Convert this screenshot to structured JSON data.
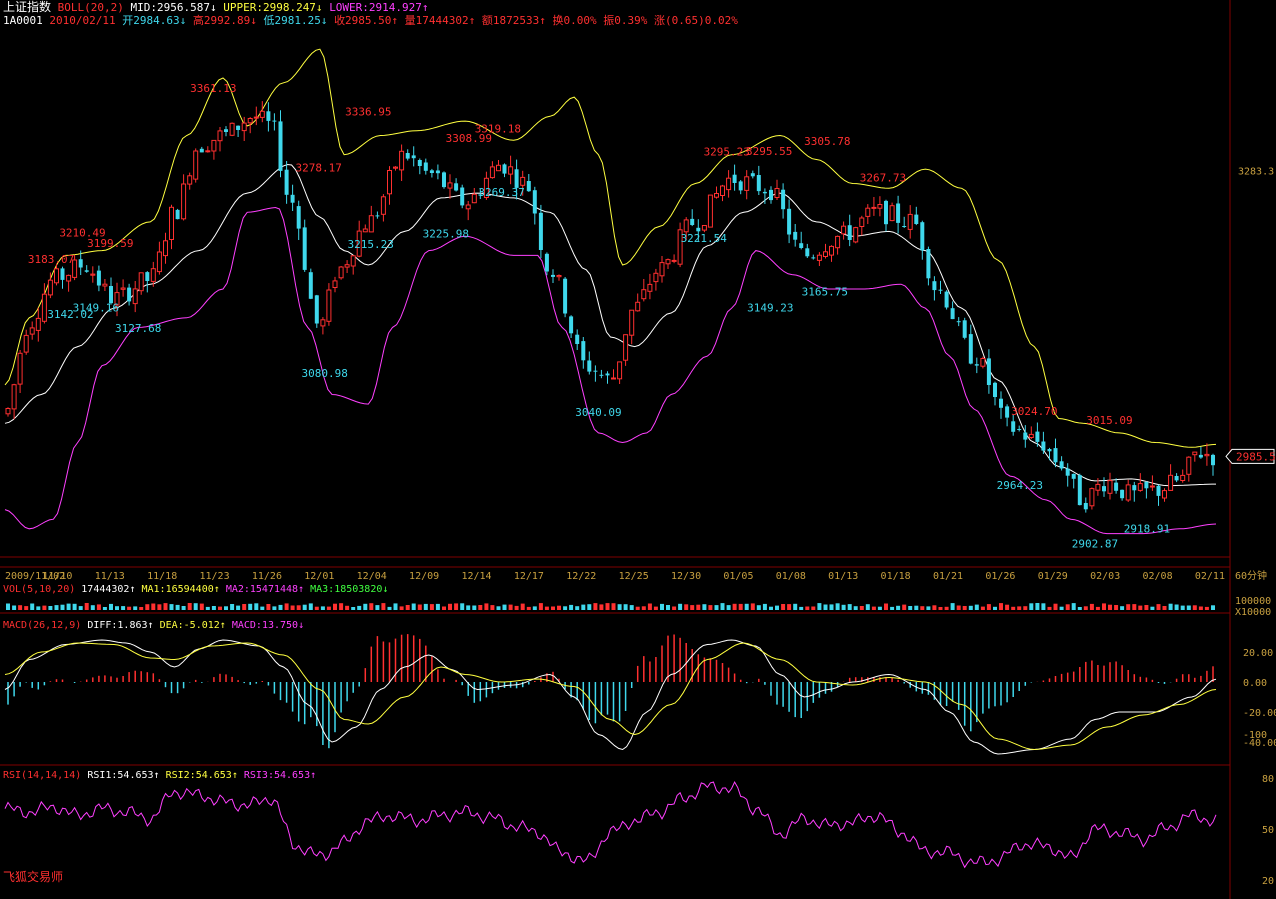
{
  "header": {
    "index_name": "上证指数",
    "boll_label": "BOLL(20,2)",
    "mid": "MID:2956.587↓",
    "upper": "UPPER:2998.247↓",
    "lower": "LOWER:2914.927↑",
    "code": "1A0001",
    "date": "2010/02/11",
    "open": "开2984.63↓",
    "high": "高2992.89↓",
    "low": "低2981.25↓",
    "close": "收2985.50↑",
    "volume": "量17444302↑",
    "amount": "额1872533↑",
    "turnover": "换0.00%",
    "amplitude": "振0.39%",
    "change": "涨(0.65)0.02%"
  },
  "vol_header": {
    "label": "VOL(5,10,20)",
    "value": "17444302↑",
    "ma1": "MA1:16594400↑",
    "ma2": "MA2:15471448↑",
    "ma3": "MA3:18503820↓"
  },
  "macd_header": {
    "label": "MACD(26,12,9)",
    "diff": "DIFF:1.863↑",
    "dea": "DEA:-5.012↑",
    "macd": "MACD:13.750↓"
  },
  "rsi_header": {
    "label": "RSI(14,14,14)",
    "rsi1": "RSI1:54.653↑",
    "rsi2": "RSI2:54.653↑",
    "rsi3": "RSI3:54.653↑"
  },
  "watermark": "飞狐交易师",
  "colors": {
    "up": "#ff3030",
    "down": "#3fd8ec",
    "mid": "#ffffff",
    "upper": "#ffff40",
    "lower": "#ff40ff"
  },
  "chart_data": {
    "type": "candlestick",
    "period_label": "60分钟",
    "x_ticks": [
      "2009/11/02",
      "11/10",
      "11/13",
      "11/18",
      "11/23",
      "11/26",
      "12/01",
      "12/04",
      "12/09",
      "12/14",
      "12/17",
      "12/22",
      "12/25",
      "12/30",
      "01/05",
      "01/08",
      "01/13",
      "01/18",
      "01/21",
      "01/26",
      "01/29",
      "02/03",
      "02/08",
      "02/11"
    ],
    "price_axis_labels": [
      {
        "value": 3283.3,
        "text": "3283.3"
      }
    ],
    "last_price_tag": "2985.5",
    "annotations": [
      {
        "text": "3361.13",
        "value": 3361.13,
        "kind": "high",
        "x": 0.172
      },
      {
        "text": "3336.95",
        "value": 3336.95,
        "kind": "high",
        "x": 0.3
      },
      {
        "text": "3308.99",
        "value": 3308.99,
        "kind": "high",
        "x": 0.383
      },
      {
        "text": "3319.18",
        "value": 3319.18,
        "kind": "high",
        "x": 0.407
      },
      {
        "text": "3305.78",
        "value": 3305.78,
        "kind": "high",
        "x": 0.679
      },
      {
        "text": "3295.23",
        "value": 3295.23,
        "kind": "high",
        "x": 0.596
      },
      {
        "text": "3295.55",
        "value": 3295.55,
        "kind": "high",
        "x": 0.631
      },
      {
        "text": "3278.17",
        "value": 3278.17,
        "kind": "high",
        "x": 0.259
      },
      {
        "text": "3267.73",
        "value": 3267.73,
        "kind": "high",
        "x": 0.725
      },
      {
        "text": "3210.49",
        "value": 3210.49,
        "kind": "high",
        "x": 0.064
      },
      {
        "text": "3199.59",
        "value": 3199.59,
        "kind": "high",
        "x": 0.087
      },
      {
        "text": "3183.07",
        "value": 3183.07,
        "kind": "high",
        "x": 0.038
      },
      {
        "text": "3024.70",
        "value": 3024.7,
        "kind": "high",
        "x": 0.85
      },
      {
        "text": "3015.09",
        "value": 3015.09,
        "kind": "high",
        "x": 0.912
      },
      {
        "text": "3269.37",
        "value": 3269.37,
        "kind": "low",
        "x": 0.41
      },
      {
        "text": "3215.23",
        "value": 3215.23,
        "kind": "low",
        "x": 0.302
      },
      {
        "text": "3225.98",
        "value": 3225.98,
        "kind": "low",
        "x": 0.364
      },
      {
        "text": "3221.54",
        "value": 3221.54,
        "kind": "low",
        "x": 0.577
      },
      {
        "text": "3165.75",
        "value": 3165.75,
        "kind": "low",
        "x": 0.677
      },
      {
        "text": "3149.23",
        "value": 3149.23,
        "kind": "low",
        "x": 0.632
      },
      {
        "text": "3149.16",
        "value": 3149.16,
        "kind": "low",
        "x": 0.075
      },
      {
        "text": "3142.02",
        "value": 3142.02,
        "kind": "low",
        "x": 0.054
      },
      {
        "text": "3127.68",
        "value": 3127.68,
        "kind": "low",
        "x": 0.11
      },
      {
        "text": "3080.98",
        "value": 3080.98,
        "kind": "low",
        "x": 0.264
      },
      {
        "text": "3040.09",
        "value": 3040.09,
        "kind": "low",
        "x": 0.49
      },
      {
        "text": "2964.23",
        "value": 2964.23,
        "kind": "low",
        "x": 0.838
      },
      {
        "text": "2918.91",
        "value": 2918.91,
        "kind": "low",
        "x": 0.943
      },
      {
        "text": "2902.87",
        "value": 2902.87,
        "kind": "low",
        "x": 0.9
      }
    ],
    "price_anchors": {
      "close": [
        [
          0,
          3030
        ],
        [
          0.02,
          3125
        ],
        [
          0.04,
          3170
        ],
        [
          0.065,
          3185
        ],
        [
          0.09,
          3150
        ],
        [
          0.12,
          3170
        ],
        [
          0.14,
          3240
        ],
        [
          0.16,
          3310
        ],
        [
          0.18,
          3320
        ],
        [
          0.205,
          3340
        ],
        [
          0.22,
          3330
        ],
        [
          0.235,
          3255
        ],
        [
          0.26,
          3120
        ],
        [
          0.275,
          3180
        ],
        [
          0.3,
          3230
        ],
        [
          0.33,
          3300
        ],
        [
          0.35,
          3280
        ],
        [
          0.38,
          3250
        ],
        [
          0.41,
          3290
        ],
        [
          0.43,
          3270
        ],
        [
          0.45,
          3180
        ],
        [
          0.48,
          3080
        ],
        [
          0.5,
          3065
        ],
        [
          0.52,
          3140
        ],
        [
          0.54,
          3180
        ],
        [
          0.57,
          3230
        ],
        [
          0.6,
          3275
        ],
        [
          0.63,
          3265
        ],
        [
          0.66,
          3195
        ],
        [
          0.69,
          3215
        ],
        [
          0.72,
          3240
        ],
        [
          0.75,
          3230
        ],
        [
          0.77,
          3160
        ],
        [
          0.8,
          3090
        ],
        [
          0.83,
          3015
        ],
        [
          0.855,
          3000
        ],
        [
          0.87,
          2980
        ],
        [
          0.89,
          2940
        ],
        [
          0.91,
          2960
        ],
        [
          0.93,
          2945
        ],
        [
          0.95,
          2950
        ],
        [
          0.97,
          2960
        ],
        [
          0.985,
          2990
        ],
        [
          1.0,
          2985.5
        ]
      ],
      "upper": [
        [
          0,
          3060
        ],
        [
          0.02,
          3130
        ],
        [
          0.05,
          3195
        ],
        [
          0.08,
          3200
        ],
        [
          0.12,
          3230
        ],
        [
          0.15,
          3320
        ],
        [
          0.18,
          3380
        ],
        [
          0.2,
          3330
        ],
        [
          0.23,
          3375
        ],
        [
          0.26,
          3410
        ],
        [
          0.28,
          3300
        ],
        [
          0.31,
          3320
        ],
        [
          0.34,
          3325
        ],
        [
          0.38,
          3335
        ],
        [
          0.42,
          3315
        ],
        [
          0.45,
          3340
        ],
        [
          0.47,
          3360
        ],
        [
          0.49,
          3300
        ],
        [
          0.51,
          3185
        ],
        [
          0.54,
          3225
        ],
        [
          0.57,
          3270
        ],
        [
          0.6,
          3300
        ],
        [
          0.64,
          3320
        ],
        [
          0.67,
          3295
        ],
        [
          0.7,
          3270
        ],
        [
          0.73,
          3265
        ],
        [
          0.76,
          3285
        ],
        [
          0.79,
          3265
        ],
        [
          0.82,
          3190
        ],
        [
          0.85,
          3100
        ],
        [
          0.87,
          3025
        ],
        [
          0.89,
          3020
        ],
        [
          0.92,
          3010
        ],
        [
          0.95,
          3000
        ],
        [
          0.98,
          2995
        ],
        [
          1.0,
          2998
        ]
      ],
      "mid": [
        [
          0,
          3020
        ],
        [
          0.03,
          3050
        ],
        [
          0.06,
          3100
        ],
        [
          0.09,
          3140
        ],
        [
          0.12,
          3165
        ],
        [
          0.16,
          3200
        ],
        [
          0.2,
          3260
        ],
        [
          0.235,
          3290
        ],
        [
          0.26,
          3235
        ],
        [
          0.28,
          3200
        ],
        [
          0.3,
          3185
        ],
        [
          0.33,
          3220
        ],
        [
          0.36,
          3255
        ],
        [
          0.39,
          3260
        ],
        [
          0.42,
          3255
        ],
        [
          0.45,
          3240
        ],
        [
          0.48,
          3180
        ],
        [
          0.5,
          3110
        ],
        [
          0.52,
          3100
        ],
        [
          0.55,
          3135
        ],
        [
          0.58,
          3205
        ],
        [
          0.61,
          3240
        ],
        [
          0.64,
          3260
        ],
        [
          0.67,
          3230
        ],
        [
          0.7,
          3215
        ],
        [
          0.73,
          3220
        ],
        [
          0.76,
          3200
        ],
        [
          0.79,
          3140
        ],
        [
          0.82,
          3065
        ],
        [
          0.85,
          3000
        ],
        [
          0.87,
          2975
        ],
        [
          0.9,
          2960
        ],
        [
          0.93,
          2962
        ],
        [
          0.96,
          2955
        ],
        [
          1.0,
          2956.6
        ]
      ],
      "lower": [
        [
          0,
          2930
        ],
        [
          0.02,
          2910
        ],
        [
          0.04,
          2920
        ],
        [
          0.06,
          3000
        ],
        [
          0.08,
          3080
        ],
        [
          0.11,
          3120
        ],
        [
          0.15,
          3130
        ],
        [
          0.18,
          3160
        ],
        [
          0.2,
          3240
        ],
        [
          0.225,
          3245
        ],
        [
          0.25,
          3120
        ],
        [
          0.27,
          3050
        ],
        [
          0.3,
          3040
        ],
        [
          0.32,
          3120
        ],
        [
          0.35,
          3200
        ],
        [
          0.38,
          3215
        ],
        [
          0.42,
          3195
        ],
        [
          0.44,
          3195
        ],
        [
          0.46,
          3120
        ],
        [
          0.49,
          3010
        ],
        [
          0.51,
          3000
        ],
        [
          0.53,
          3010
        ],
        [
          0.55,
          3050
        ],
        [
          0.58,
          3090
        ],
        [
          0.6,
          3140
        ],
        [
          0.62,
          3200
        ],
        [
          0.65,
          3175
        ],
        [
          0.68,
          3160
        ],
        [
          0.71,
          3160
        ],
        [
          0.74,
          3165
        ],
        [
          0.76,
          3140
        ],
        [
          0.78,
          3090
        ],
        [
          0.8,
          3035
        ],
        [
          0.83,
          2965
        ],
        [
          0.86,
          2940
        ],
        [
          0.88,
          2920
        ],
        [
          0.91,
          2905
        ],
        [
          0.94,
          2905
        ],
        [
          0.97,
          2910
        ],
        [
          1.0,
          2915
        ]
      ]
    },
    "price_range": [
      2890,
      3430
    ],
    "macd_axis_labels": [
      "20.00",
      "0.00",
      "-20.00",
      "-40.00",
      "-100"
    ],
    "macd_range": [
      -52,
      28
    ],
    "macd_anchors": {
      "diff": [
        [
          0,
          -5
        ],
        [
          0.02,
          15
        ],
        [
          0.05,
          25
        ],
        [
          0.08,
          28
        ],
        [
          0.1,
          26
        ],
        [
          0.12,
          20
        ],
        [
          0.14,
          10
        ],
        [
          0.16,
          22
        ],
        [
          0.18,
          28
        ],
        [
          0.21,
          24
        ],
        [
          0.23,
          10
        ],
        [
          0.25,
          -15
        ],
        [
          0.27,
          -40
        ],
        [
          0.29,
          -30
        ],
        [
          0.31,
          -5
        ],
        [
          0.33,
          10
        ],
        [
          0.35,
          18
        ],
        [
          0.37,
          8
        ],
        [
          0.39,
          -5
        ],
        [
          0.42,
          -2
        ],
        [
          0.45,
          5
        ],
        [
          0.47,
          -10
        ],
        [
          0.49,
          -35
        ],
        [
          0.51,
          -45
        ],
        [
          0.53,
          -20
        ],
        [
          0.55,
          5
        ],
        [
          0.58,
          25
        ],
        [
          0.6,
          28
        ],
        [
          0.62,
          24
        ],
        [
          0.64,
          5
        ],
        [
          0.66,
          -10
        ],
        [
          0.68,
          -5
        ],
        [
          0.7,
          0
        ],
        [
          0.73,
          5
        ],
        [
          0.76,
          -5
        ],
        [
          0.78,
          -20
        ],
        [
          0.8,
          -40
        ],
        [
          0.82,
          -48
        ],
        [
          0.85,
          -45
        ],
        [
          0.88,
          -38
        ],
        [
          0.9,
          -25
        ],
        [
          0.92,
          -20
        ],
        [
          0.95,
          -20
        ],
        [
          0.98,
          -10
        ],
        [
          1.0,
          1.863
        ]
      ],
      "dea": [
        [
          0,
          5
        ],
        [
          0.03,
          20
        ],
        [
          0.06,
          26
        ],
        [
          0.09,
          25
        ],
        [
          0.12,
          16
        ],
        [
          0.14,
          15
        ],
        [
          0.17,
          24
        ],
        [
          0.2,
          26
        ],
        [
          0.23,
          18
        ],
        [
          0.26,
          -5
        ],
        [
          0.28,
          -25
        ],
        [
          0.3,
          -28
        ],
        [
          0.33,
          -10
        ],
        [
          0.36,
          10
        ],
        [
          0.38,
          5
        ],
        [
          0.41,
          0
        ],
        [
          0.44,
          2
        ],
        [
          0.47,
          -3
        ],
        [
          0.5,
          -25
        ],
        [
          0.52,
          -35
        ],
        [
          0.55,
          -15
        ],
        [
          0.58,
          15
        ],
        [
          0.61,
          26
        ],
        [
          0.64,
          15
        ],
        [
          0.67,
          0
        ],
        [
          0.7,
          -2
        ],
        [
          0.73,
          3
        ],
        [
          0.76,
          0
        ],
        [
          0.79,
          -15
        ],
        [
          0.82,
          -38
        ],
        [
          0.85,
          -45
        ],
        [
          0.88,
          -42
        ],
        [
          0.91,
          -30
        ],
        [
          0.94,
          -22
        ],
        [
          0.97,
          -15
        ],
        [
          1.0,
          -5.012
        ]
      ]
    },
    "rsi_axis_labels": [
      "80",
      "50",
      "20"
    ],
    "rsi_range": [
      20,
      80
    ],
    "rsi_anchors": [
      [
        0,
        62
      ],
      [
        0.02,
        60
      ],
      [
        0.04,
        63
      ],
      [
        0.06,
        58
      ],
      [
        0.08,
        62
      ],
      [
        0.1,
        60
      ],
      [
        0.12,
        56
      ],
      [
        0.14,
        72
      ],
      [
        0.16,
        70
      ],
      [
        0.18,
        66
      ],
      [
        0.2,
        64
      ],
      [
        0.22,
        68
      ],
      [
        0.24,
        40
      ],
      [
        0.26,
        34
      ],
      [
        0.28,
        42
      ],
      [
        0.3,
        55
      ],
      [
        0.32,
        58
      ],
      [
        0.34,
        55
      ],
      [
        0.36,
        58
      ],
      [
        0.38,
        60
      ],
      [
        0.4,
        57
      ],
      [
        0.42,
        52
      ],
      [
        0.44,
        48
      ],
      [
        0.46,
        36
      ],
      [
        0.48,
        31
      ],
      [
        0.5,
        48
      ],
      [
        0.52,
        55
      ],
      [
        0.54,
        60
      ],
      [
        0.56,
        68
      ],
      [
        0.58,
        75
      ],
      [
        0.6,
        74
      ],
      [
        0.62,
        62
      ],
      [
        0.64,
        47
      ],
      [
        0.66,
        56
      ],
      [
        0.68,
        52
      ],
      [
        0.7,
        54
      ],
      [
        0.72,
        58
      ],
      [
        0.74,
        48
      ],
      [
        0.76,
        37
      ],
      [
        0.78,
        36
      ],
      [
        0.8,
        30
      ],
      [
        0.82,
        32
      ],
      [
        0.84,
        41
      ],
      [
        0.86,
        40
      ],
      [
        0.88,
        33
      ],
      [
        0.9,
        50
      ],
      [
        0.92,
        48
      ],
      [
        0.94,
        44
      ],
      [
        0.96,
        51
      ],
      [
        0.98,
        58
      ],
      [
        1.0,
        54.653
      ]
    ]
  }
}
